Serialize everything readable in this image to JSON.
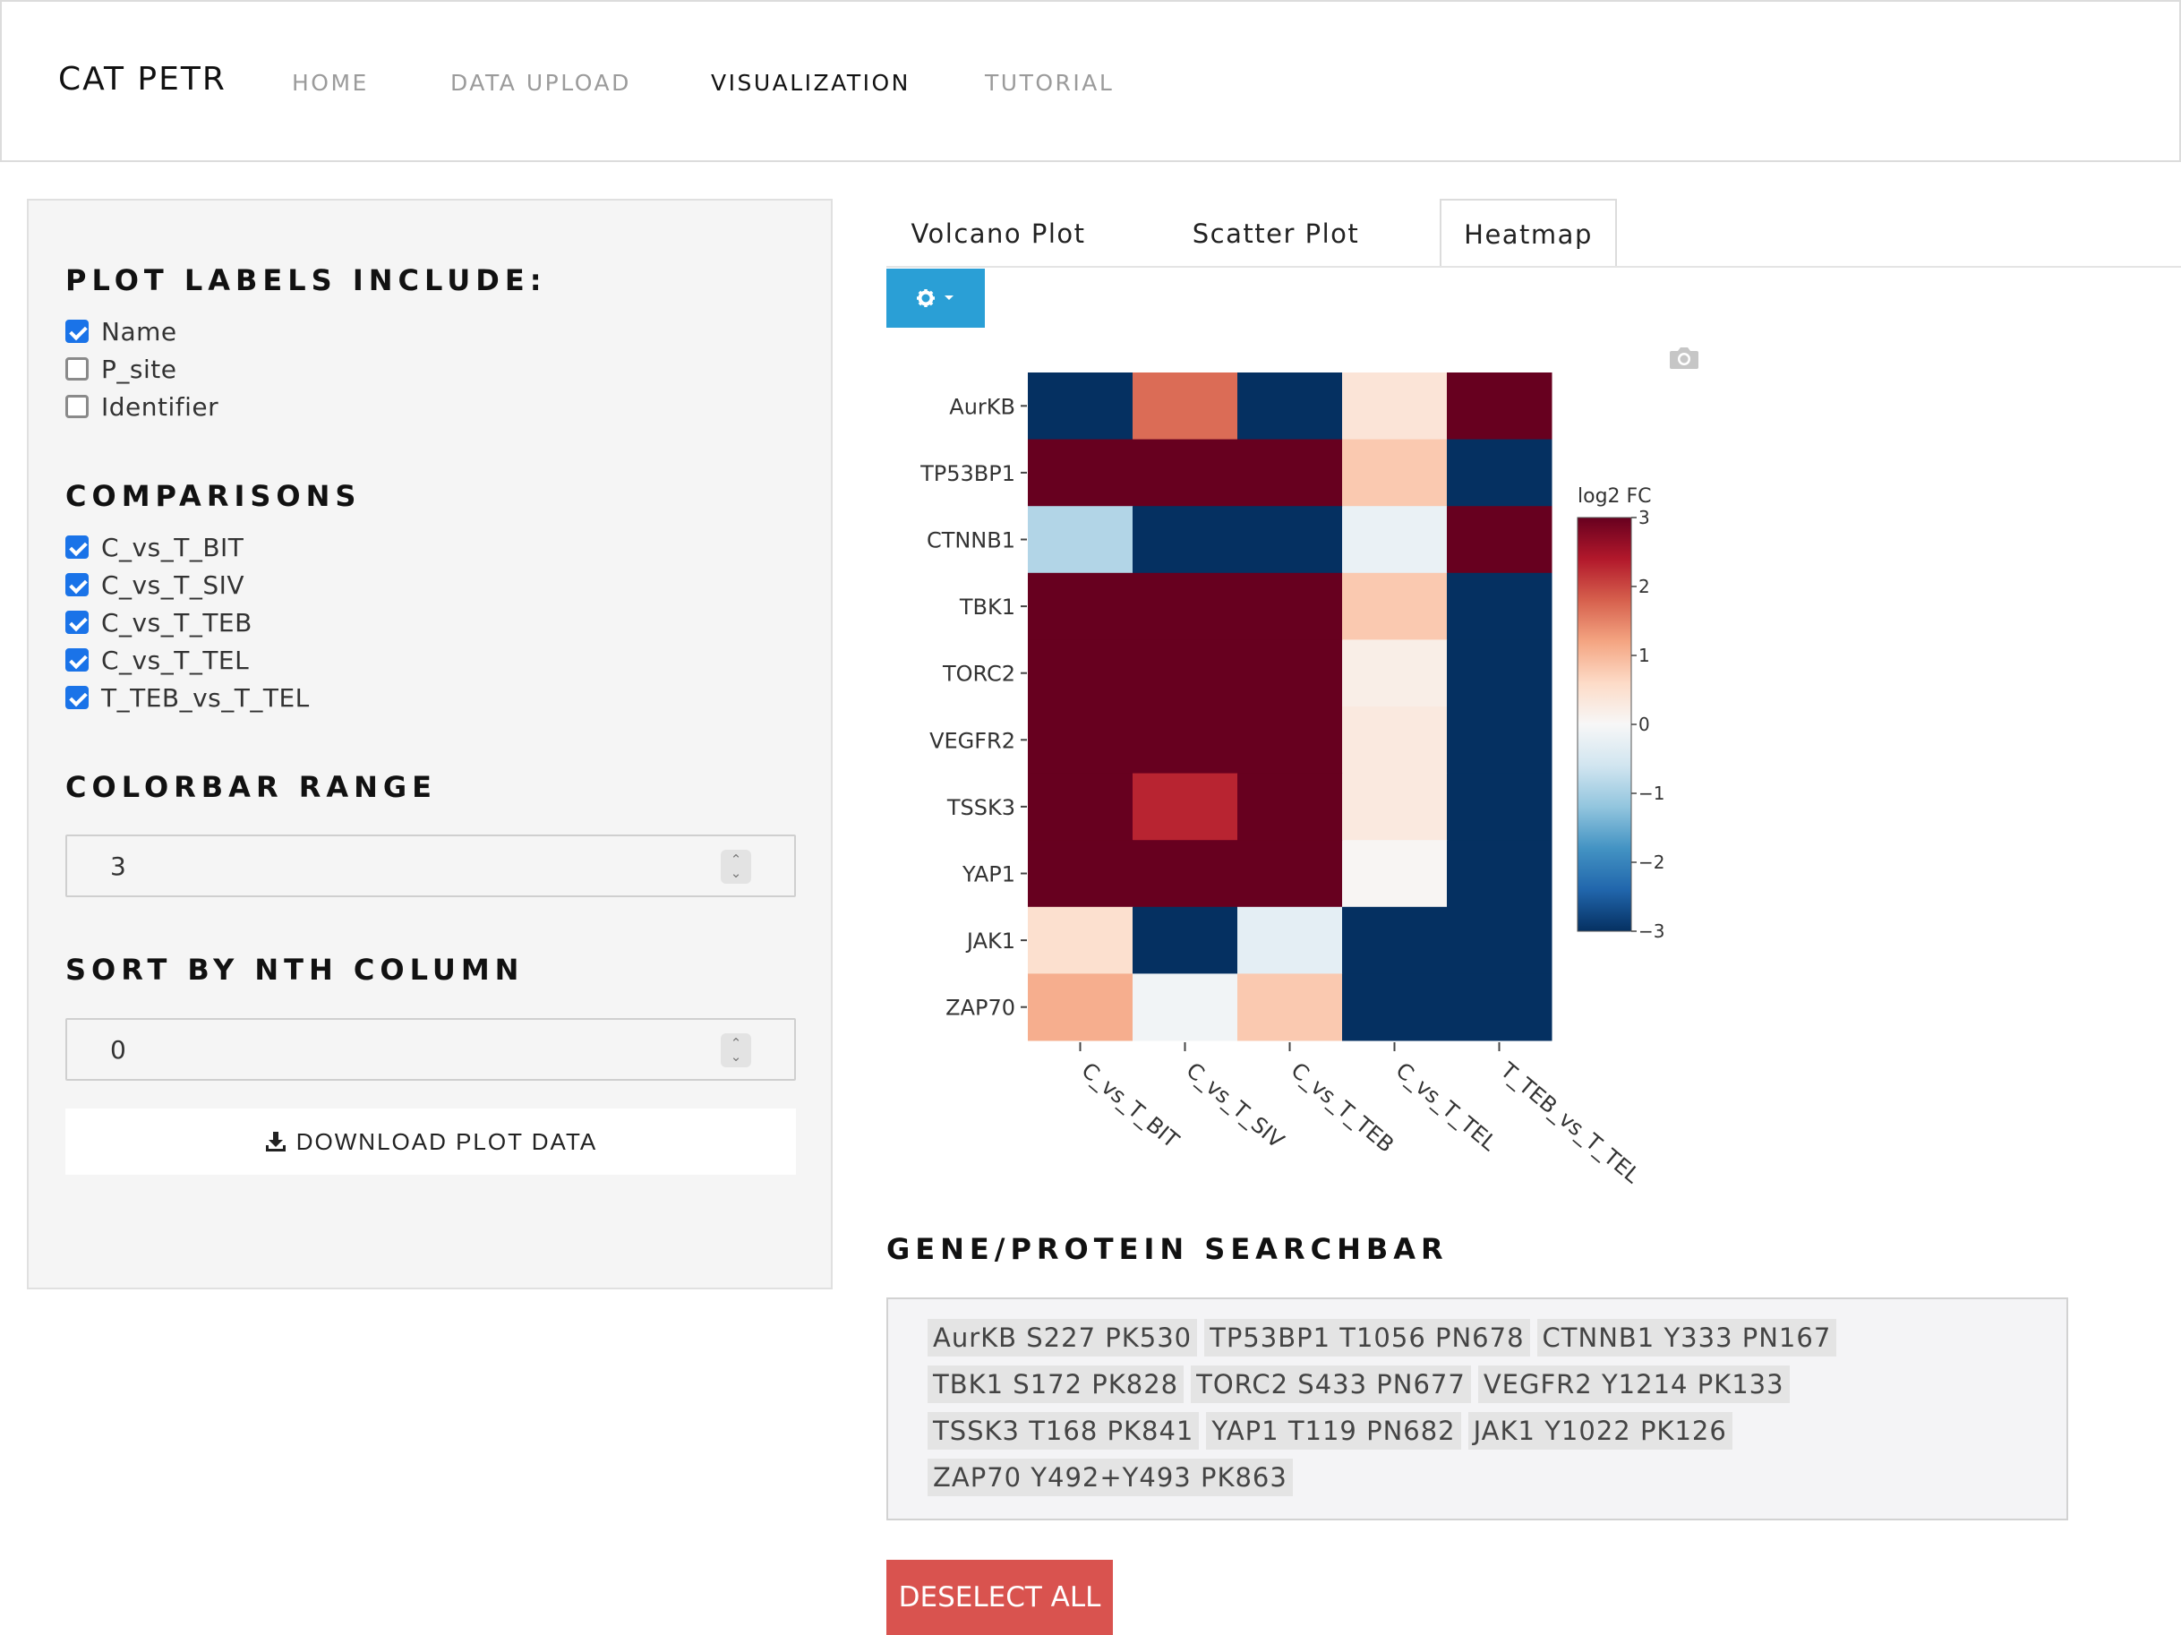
{
  "app": {
    "title": "CAT PETR"
  },
  "nav": {
    "items": [
      "HOME",
      "DATA UPLOAD",
      "VISUALIZATION",
      "TUTORIAL"
    ],
    "active": "VISUALIZATION"
  },
  "sidebar": {
    "plot_labels_title": "PLOT LABELS INCLUDE:",
    "plot_labels": [
      {
        "label": "Name",
        "checked": true
      },
      {
        "label": "P_site",
        "checked": false
      },
      {
        "label": "Identifier",
        "checked": false
      }
    ],
    "comparisons_title": "COMPARISONS",
    "comparisons": [
      {
        "label": "C_vs_T_BIT",
        "checked": true
      },
      {
        "label": "C_vs_T_SIV",
        "checked": true
      },
      {
        "label": "C_vs_T_TEB",
        "checked": true
      },
      {
        "label": "C_vs_T_TEL",
        "checked": true
      },
      {
        "label": "T_TEB_vs_T_TEL",
        "checked": true
      }
    ],
    "colorbar_title": "COLORBAR RANGE",
    "colorbar_value": "3",
    "sort_title": "SORT BY NTH COLUMN",
    "sort_value": "0",
    "download_label": "DOWNLOAD PLOT DATA"
  },
  "tabs": {
    "items": [
      "Volcano Plot",
      "Scatter Plot",
      "Heatmap"
    ],
    "active": "Heatmap"
  },
  "icons": {
    "settings": "gear-icon",
    "caret": "caret-down-icon",
    "camera": "camera-icon",
    "download": "download-icon"
  },
  "chart_data": {
    "type": "heatmap",
    "rows": [
      "AurKB",
      "TP53BP1",
      "CTNNB1",
      "TBK1",
      "TORC2",
      "VEGFR2",
      "TSSK3",
      "YAP1",
      "JAK1",
      "ZAP70"
    ],
    "columns": [
      "C_vs_T_BIT",
      "C_vs_T_SIV",
      "C_vs_T_TEB",
      "C_vs_T_TEL",
      "T_TEB_vs_T_TEL"
    ],
    "values": [
      [
        -3,
        1.7,
        -3,
        0.4,
        3
      ],
      [
        3,
        3,
        3,
        0.8,
        -3
      ],
      [
        -0.9,
        -3,
        -3,
        -0.2,
        3
      ],
      [
        3,
        3,
        3,
        0.8,
        -3
      ],
      [
        3,
        3,
        3,
        0.2,
        -3
      ],
      [
        3,
        3,
        3,
        0.3,
        -3
      ],
      [
        3,
        2.3,
        3,
        0.3,
        -3
      ],
      [
        3,
        3,
        3,
        0.05,
        -3
      ],
      [
        0.5,
        -3,
        -0.3,
        -3,
        -3
      ],
      [
        1.1,
        -0.1,
        0.8,
        -3,
        -3
      ]
    ],
    "zmin": -3,
    "zmax": 3,
    "colorscale": [
      "#053061",
      "#2166ac",
      "#4393c3",
      "#92c5de",
      "#d1e5f0",
      "#f7f7f7",
      "#fddbc7",
      "#f4a582",
      "#d6604d",
      "#b2182b",
      "#67001f"
    ],
    "colorbar_title": "log2 FC",
    "colorbar_ticks": [
      "3",
      "2",
      "1",
      "0",
      "−1",
      "−2",
      "−3"
    ]
  },
  "search": {
    "title": "GENE/PROTEIN SEARCHBAR",
    "tags": [
      "AurKB S227 PK530",
      "TP53BP1 T1056 PN678",
      "CTNNB1 Y333 PN167",
      "TBK1 S172 PK828",
      "TORC2 S433 PN677",
      "VEGFR2 Y1214 PK133",
      "TSSK3 T168 PK841",
      "YAP1 T119 PN682",
      "JAK1 Y1022 PK126",
      "ZAP70 Y492+Y493 PK863"
    ]
  },
  "deselect_label": "DESELECT ALL"
}
